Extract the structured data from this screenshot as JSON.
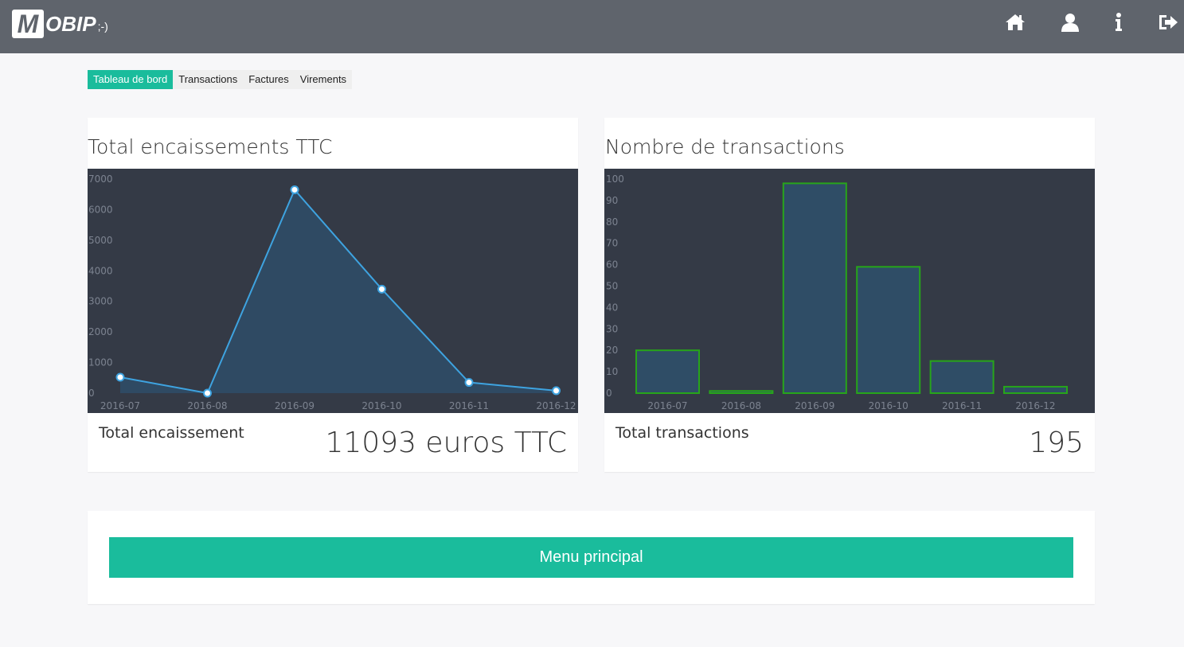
{
  "header": {
    "logo_letter": "M",
    "logo_text": "OBIP",
    "logo_smile": ";-)",
    "icons": [
      "home-icon",
      "user-icon",
      "info-icon",
      "logout-icon"
    ]
  },
  "tabs": [
    {
      "label": "Tableau de bord",
      "active": true
    },
    {
      "label": "Transactions",
      "active": false
    },
    {
      "label": "Factures",
      "active": false
    },
    {
      "label": "Virements",
      "active": false
    }
  ],
  "colors": {
    "accent": "#1abc9c",
    "topbar": "#5f646c",
    "chart_bg": "#343a46",
    "line": "#3ea3e0",
    "bar_border": "#27a51a",
    "bar_fill": "#2f4d66"
  },
  "card1": {
    "title": "Total encaissements TTC",
    "footer_label": "Total encaissement",
    "footer_value": "11093 euros TTC"
  },
  "card2": {
    "title": "Nombre de transactions",
    "footer_label": "Total transactions",
    "footer_value": "195"
  },
  "menu_button": "Menu principal",
  "chart_data": [
    {
      "type": "area",
      "categories": [
        "2016-07",
        "2016-08",
        "2016-09",
        "2016-10",
        "2016-11",
        "2016-12"
      ],
      "values": [
        520,
        0,
        6650,
        3400,
        350,
        80
      ],
      "yticks": [
        "0",
        "1000",
        "2000",
        "3000",
        "4000",
        "5000",
        "6000",
        "7000"
      ],
      "ylim": [
        0,
        7000
      ]
    },
    {
      "type": "bar",
      "categories": [
        "2016-07",
        "2016-08",
        "2016-09",
        "2016-10",
        "2016-11",
        "2016-12"
      ],
      "values": [
        20,
        1,
        98,
        59,
        15,
        3
      ],
      "yticks": [
        "0",
        "10",
        "20",
        "30",
        "40",
        "50",
        "60",
        "70",
        "80",
        "90",
        "100"
      ],
      "ylim": [
        0,
        100
      ]
    }
  ]
}
